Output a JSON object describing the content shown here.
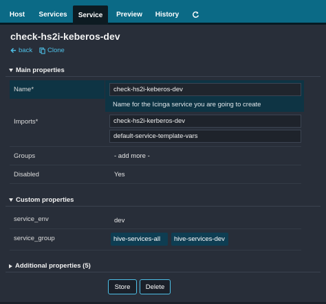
{
  "tabs": [
    {
      "label": "Host",
      "active": false
    },
    {
      "label": "Services",
      "active": false
    },
    {
      "label": "Service",
      "active": true
    },
    {
      "label": "Preview",
      "active": false
    },
    {
      "label": "History",
      "active": false
    }
  ],
  "tabs_refresh_icon": "refresh-icon",
  "page_title": "check-hs2i-keberos-dev",
  "actions": {
    "back": "back",
    "clone": "Clone"
  },
  "sections": {
    "main": "Main properties",
    "custom": "Custom properties",
    "additional": "Additional properties (5)"
  },
  "fields": {
    "name": {
      "label": "Name*",
      "value": "check-hs2i-keberos-dev",
      "hint": "Name for the Icinga service you are going to create"
    },
    "imports": {
      "label": "Imports*",
      "values": [
        "check-hs2i-kerberos-dev",
        "default-service-template-vars"
      ]
    },
    "groups": {
      "label": "Groups",
      "value": "- add more -"
    },
    "disabled": {
      "label": "Disabled",
      "value": "Yes"
    }
  },
  "custom": {
    "service_env": {
      "label": "service_env",
      "value": "dev"
    },
    "service_group": {
      "label": "service_group",
      "values": [
        "hive-services-all",
        "hive-services-dev"
      ]
    }
  },
  "buttons": {
    "store": "Store",
    "delete": "Delete"
  },
  "colors": {
    "topbar": "#0b6a86",
    "accent": "#4ec1e8",
    "background": "#282e39"
  }
}
